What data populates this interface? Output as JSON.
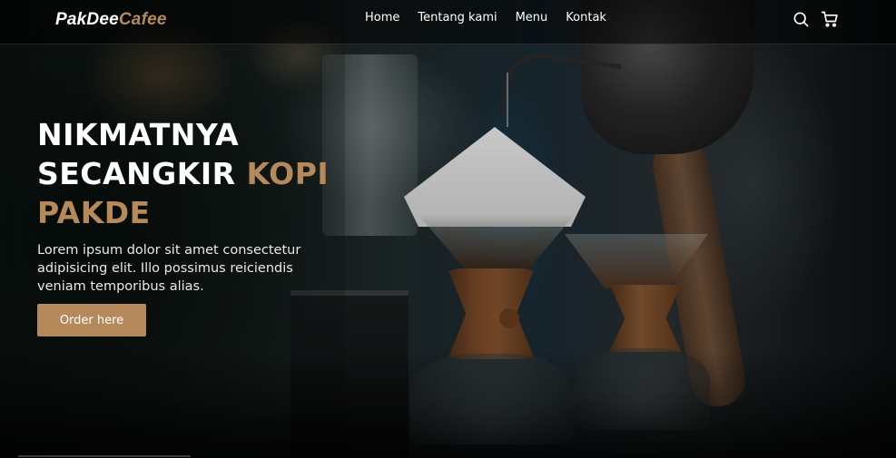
{
  "brand": {
    "name_part1": "PakDee",
    "name_part2": "Cafee",
    "accent_color": "#b6895b"
  },
  "nav": {
    "links": [
      {
        "label": "Home"
      },
      {
        "label": "Tentang kami"
      },
      {
        "label": "Menu"
      },
      {
        "label": "Kontak"
      }
    ],
    "icons": [
      "search-icon",
      "cart-icon"
    ]
  },
  "hero": {
    "title_line1": "NIKMATNYA",
    "title_line2_white": "SECANGKIR",
    "title_line2_accent": "KOPI",
    "title_line3_accent": "PAKDE",
    "description": "Lorem ipsum dolor sit amet consectetur adipisicing elit. Illo possimus reiciendis veniam temporibus alias.",
    "cta_label": "Order here"
  }
}
